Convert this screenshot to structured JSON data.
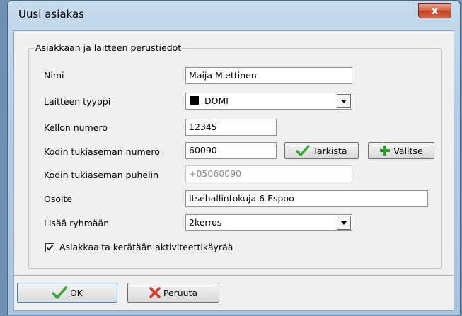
{
  "window": {
    "title": "Uusi asiakas",
    "close_label": "x"
  },
  "group": {
    "title": "Asiakkaan ja laitteen perustiedot"
  },
  "fields": {
    "name": {
      "label": "Nimi",
      "value": "Maija Miettinen"
    },
    "device_type": {
      "label": "Laitteen tyyppi",
      "value": "DOMI"
    },
    "watch_number": {
      "label": "Kellon numero",
      "value": "12345"
    },
    "base_number": {
      "label": "Kodin tukiaseman numero",
      "value": "60090"
    },
    "base_phone": {
      "label": "Kodin tukiaseman puhelin",
      "value": "+05060090"
    },
    "address": {
      "label": "Osoite",
      "value": "Itsehallintokuja 6 Espoo"
    },
    "group": {
      "label": "Lisää ryhmään",
      "value": "2kerros"
    }
  },
  "buttons": {
    "check": "Tarkista",
    "select": "Valitse",
    "ok": "OK",
    "cancel": "Peruuta"
  },
  "activity": {
    "label": "Asiakkaalta kerätään aktiviteettikäyrää",
    "checked": true
  },
  "colors": {
    "check_green": "#3aa63a",
    "plus_green": "#2f9e2f",
    "cancel_red": "#d43b2a"
  }
}
